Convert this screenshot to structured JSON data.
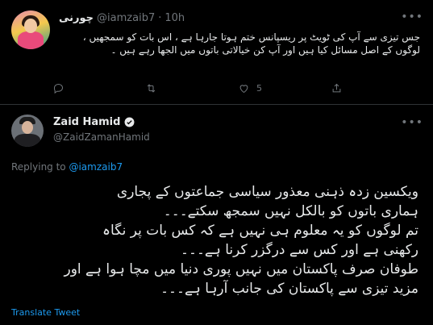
{
  "top_tweet": {
    "display_name": "چورنی",
    "handle": "@iamzaib7",
    "separator": "·",
    "time": "10h",
    "text": "جس تیزی سے آپ کی ٹویٹ پر ریسپانس ختم ہوتا جارہا ہے ، اس  بات کو سمجھیں ، لوگوں کے اصل مسائل کیا ہیں اور آپ کن خیالاتی باتوں میں الجھا رہے ہیں ۔",
    "actions": {
      "reply_count": "",
      "retweet_count": "",
      "like_count": "5"
    }
  },
  "main_tweet": {
    "display_name": "Zaid Hamid",
    "handle": "@ZaidZamanHamid",
    "replying_label": "Replying to ",
    "replying_handle": "@iamzaib7",
    "lines": [
      "ویکسین زدہ ذہنی معذور سیاسی جماعتوں  کے پجاری",
      "ہماری باتوں کو بالکل نہیں سمجھ سکتے۔۔۔",
      "تم لوگوں کو یہ معلوم ہی نہیں ہے کہ کس بات پر نگاہ",
      "رکھنی ہے اور کس سے درگزر کرنا ہے۔۔۔",
      "طوفان صرف پاکستان میں نہیں پوری دنیا میں مچا ہوا ہے اور",
      "مزید تیزی سے پاکستان کی جانب آرہا ہے۔۔۔"
    ],
    "translate_label": "Translate Tweet"
  },
  "icons": {
    "more": "more-icon",
    "reply": "reply-icon",
    "retweet": "retweet-icon",
    "like": "heart-icon",
    "share": "share-icon",
    "verified": "verified-icon"
  },
  "colors": {
    "background": "#000000",
    "text": "#e7e9ea",
    "muted": "#71767b",
    "accent": "#1d9bf0",
    "divider": "#2f3336"
  }
}
